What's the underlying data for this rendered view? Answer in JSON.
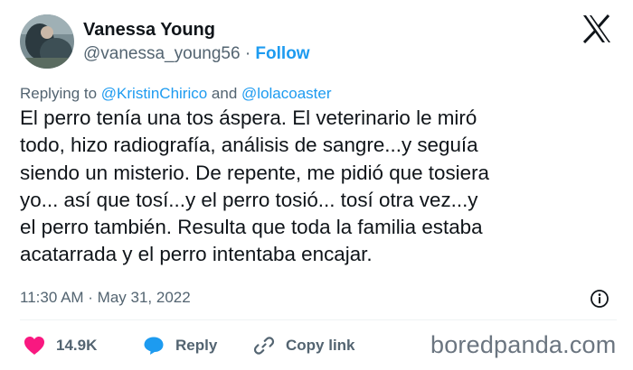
{
  "user": {
    "display_name": "Vanessa Young",
    "handle": "@vanessa_young56",
    "separator": "·",
    "follow_label": "Follow"
  },
  "reply_context": {
    "prefix": "Replying to",
    "mention_1": "@KristinChirico",
    "joiner": "and",
    "mention_2": "@lolacoaster"
  },
  "tweet": {
    "text": "El perro tenía una tos áspera. El veterinario le miró\ntodo, hizo radiografía, análisis de sangre...y seguía\nsiendo un misterio. De repente, me pidió que tosiera\nyo... así que tosí...y el perro tosió... tosí otra vez...y\nel perro también. Resulta que toda la familia estaba\nacatarrada y el perro intentaba encajar.",
    "timestamp": "11:30 AM · May 31, 2022"
  },
  "actions": {
    "likes_count": "14.9K",
    "reply_label": "Reply",
    "copy_link_label": "Copy link"
  },
  "watermark": "boredpanda.com",
  "icons": [
    "x-logo-icon",
    "info-icon",
    "heart-icon",
    "reply-bubble-icon",
    "link-icon"
  ],
  "colors": {
    "accent": "#1d9bf0",
    "heart": "#f91880",
    "secondary_text": "#536471",
    "primary_text": "#0f1419"
  }
}
